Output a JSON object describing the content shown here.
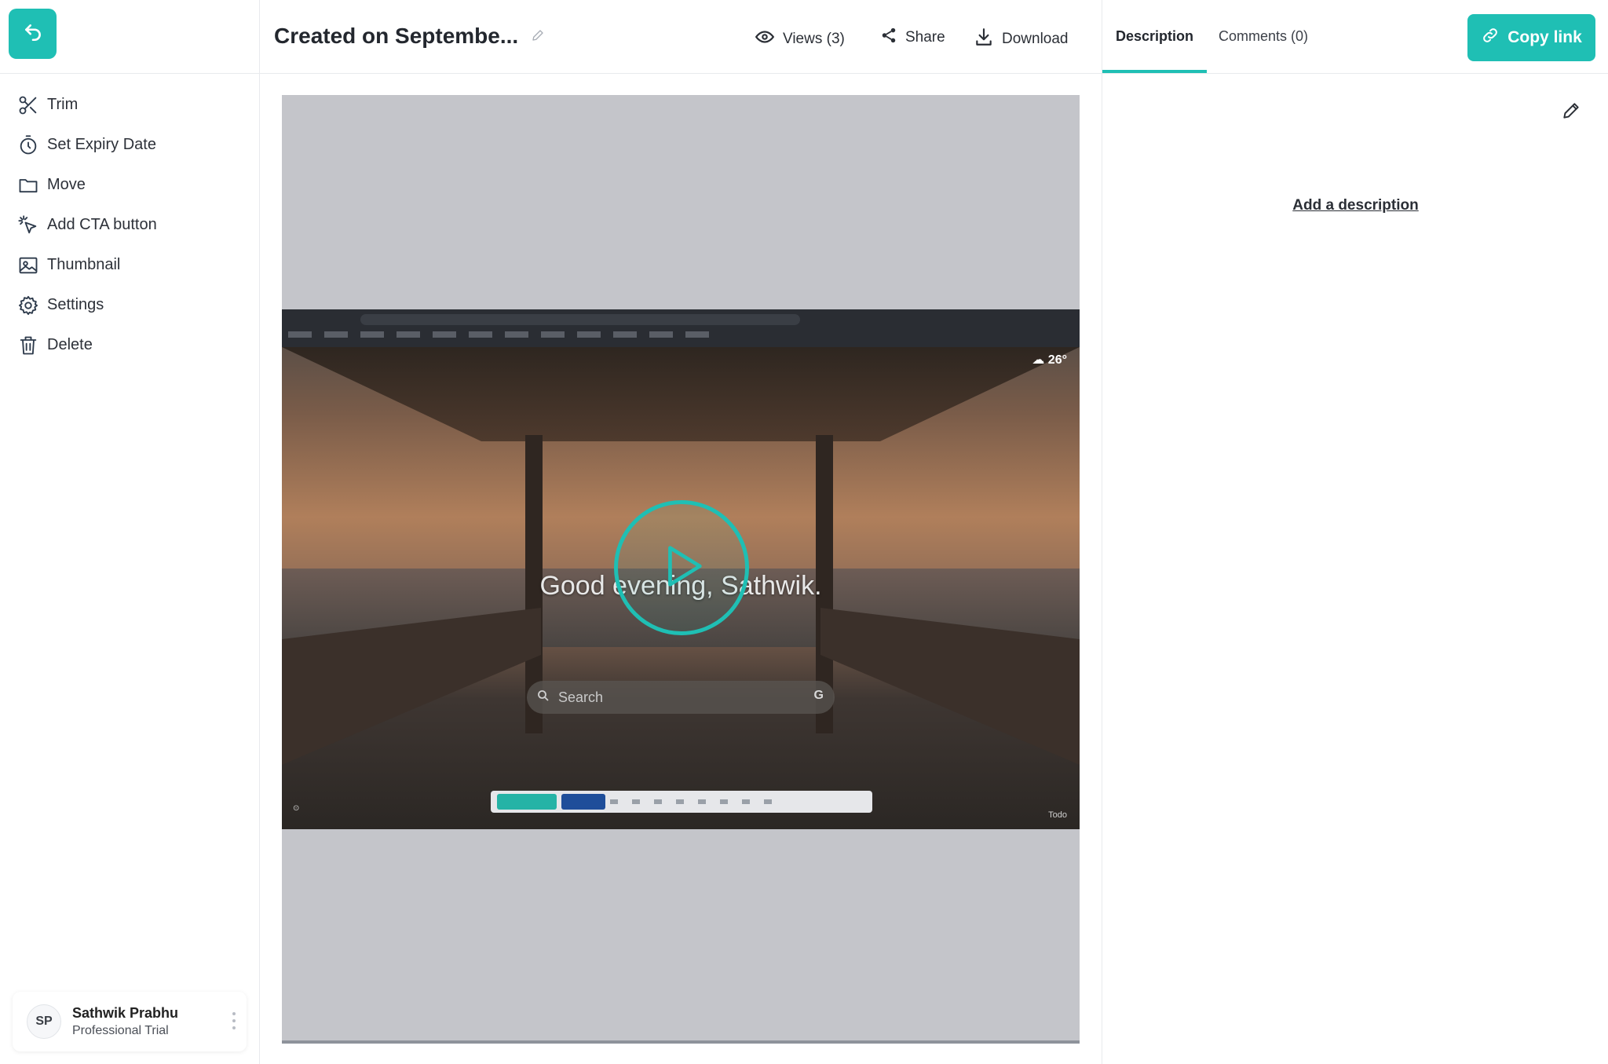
{
  "sidebar": {
    "back_icon": "undo-arrow-icon",
    "items": [
      {
        "label": "Trim",
        "icon": "scissors-icon"
      },
      {
        "label": "Set Expiry Date",
        "icon": "timer-icon"
      },
      {
        "label": "Move",
        "icon": "folder-icon"
      },
      {
        "label": "Add CTA button",
        "icon": "cursor-click-icon"
      },
      {
        "label": "Thumbnail",
        "icon": "image-icon"
      },
      {
        "label": "Settings",
        "icon": "gear-icon"
      },
      {
        "label": "Delete",
        "icon": "trash-icon"
      }
    ],
    "user": {
      "initials": "SP",
      "name": "Sathwik Prabhu",
      "plan": "Professional Trial"
    }
  },
  "header": {
    "title": "Created on Septembe...",
    "views_label": "Views (3)",
    "share_label": "Share",
    "download_label": "Download"
  },
  "video": {
    "greeting": "Good evening, Sathwik.",
    "search_placeholder": "Search",
    "search_badge": "G",
    "weather": "26°",
    "todo": "Todo"
  },
  "panel": {
    "tabs": [
      {
        "label": "Description",
        "active": true
      },
      {
        "label": "Comments (0)",
        "active": false
      }
    ],
    "copy_link_label": "Copy link",
    "add_description_label": "Add a description"
  },
  "colors": {
    "accent": "#1fbfb4",
    "stage_bg": "#c4c5ca"
  }
}
